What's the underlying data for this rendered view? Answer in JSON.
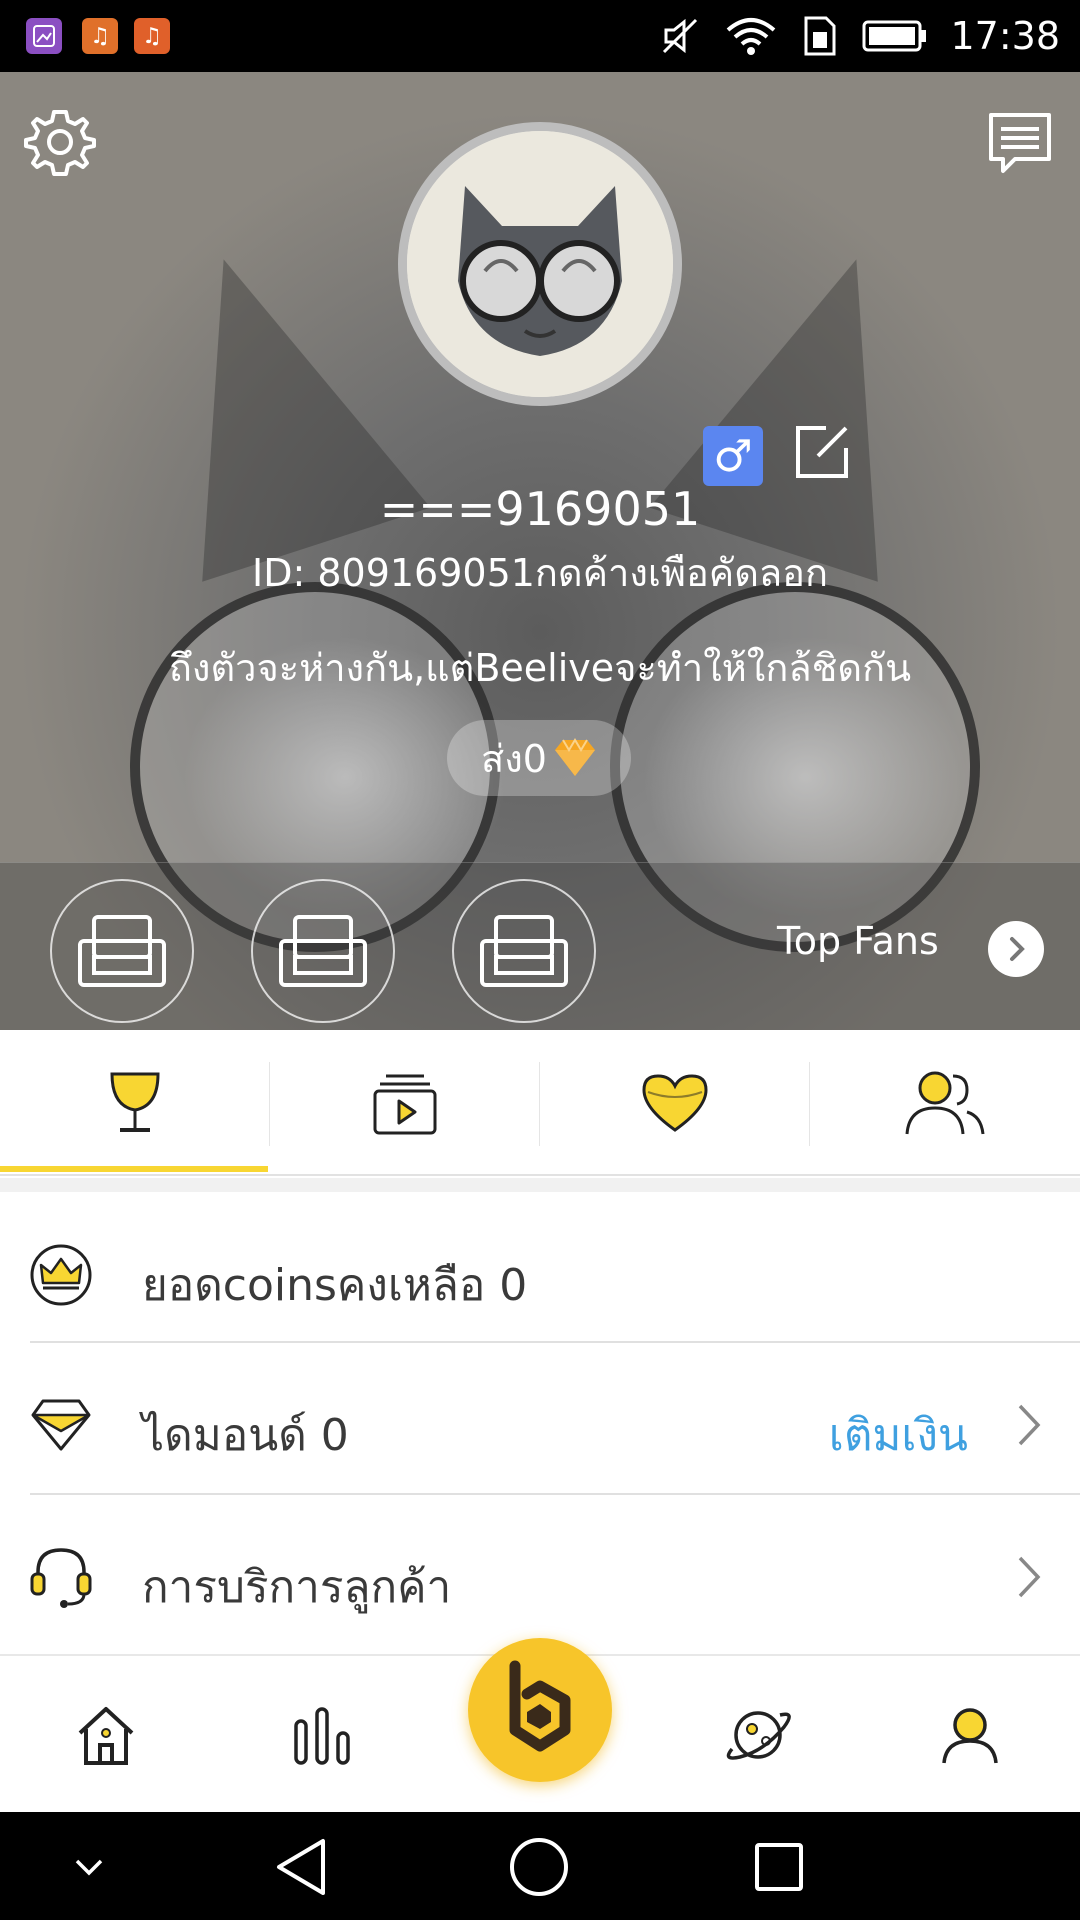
{
  "status_bar": {
    "time": "17:38",
    "apps": [
      "photo-app-icon",
      "music-app-icon",
      "music-app-icon-2"
    ]
  },
  "profile": {
    "username": "===9169051",
    "user_id_text": "ID: 809169051กดค้างเพือคัดลอก",
    "slogan": "ถึงตัวจะห่างกัน,แต่Beeliveจะทำให้ใกล้ชิดกัน",
    "send_label": "ส่ง0",
    "gender": "male"
  },
  "fans": {
    "top_fans_label": "Top Fans"
  },
  "tabs": [
    {
      "icon": "trophy-icon",
      "active": true
    },
    {
      "icon": "video-playlist-icon",
      "active": false
    },
    {
      "icon": "heart-icon",
      "active": false
    },
    {
      "icon": "users-icon",
      "active": false
    }
  ],
  "list": {
    "coins_label": "ยอดcoinsคงเหลือ 0",
    "diamond_label": "ไดมอนด์ 0",
    "topup_label": "เติมเงิน",
    "support_label": "การบริการลูกค้า"
  },
  "bottom_nav": [
    "home-icon",
    "chart-icon",
    "beelive-logo",
    "planet-icon",
    "profile-icon"
  ],
  "colors": {
    "accent": "#F8D632",
    "link": "#3FA0E0",
    "gender_badge": "#5B86F0"
  }
}
